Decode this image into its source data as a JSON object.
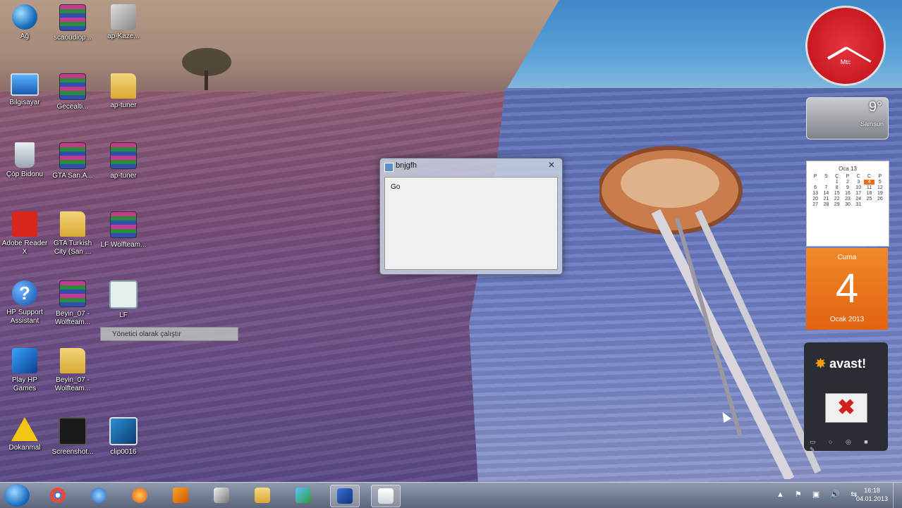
{
  "desktop": {
    "icons": [
      {
        "label": "Ağ",
        "type": "globe"
      },
      {
        "label": "scaoudiop...",
        "type": "rar"
      },
      {
        "label": "ap-Kaze...",
        "type": "setup"
      },
      {
        "label": "Bilgisayar",
        "type": "pc"
      },
      {
        "label": "Gecealti...",
        "type": "rar"
      },
      {
        "label": "ap-tuner",
        "type": "folder"
      },
      {
        "label": "Çöp Bidonu",
        "type": "trash"
      },
      {
        "label": "GTA San.A...",
        "type": "rar"
      },
      {
        "label": "ap-tuner",
        "type": "rar"
      },
      {
        "label": "Adobe Reader X",
        "type": "pdf"
      },
      {
        "label": "GTA Turkish City (San ...",
        "type": "folder"
      },
      {
        "label": "LF Wolfteam...",
        "type": "rar"
      },
      {
        "label": "HP Support Assistant",
        "type": "help"
      },
      {
        "label": "Beyin_07 - Wolfteam...",
        "type": "rar"
      },
      {
        "label": "LF",
        "type": "app"
      },
      {
        "label": "Play HP Games",
        "type": "games"
      },
      {
        "label": "Beyin_07 - Wolfteam...",
        "type": "folder"
      },
      {
        "label": "Dokanmal",
        "type": "warn"
      },
      {
        "label": "Screenshot...",
        "type": "shot"
      },
      {
        "label": "clip0016",
        "type": "clip"
      }
    ],
    "tooltip": "Yönetici olarak çalıştır"
  },
  "dialog": {
    "title": "bnjgfh",
    "close_glyph": "✕",
    "body_text": "Go"
  },
  "gadgets": {
    "clock": {
      "label": "Mtc"
    },
    "weather": {
      "temp": "9°",
      "city": "Samsun"
    },
    "calendar": {
      "month": "Oca 13",
      "weekdays": [
        "P",
        "S",
        "Ç",
        "P",
        "C",
        "C",
        "P"
      ],
      "days": [
        "",
        "",
        "1",
        "2",
        "3",
        "4",
        "5",
        "6",
        "7",
        "8",
        "9",
        "10",
        "11",
        "12",
        "13",
        "14",
        "15",
        "16",
        "17",
        "18",
        "19",
        "20",
        "21",
        "22",
        "23",
        "24",
        "25",
        "26",
        "27",
        "28",
        "29",
        "30",
        "31",
        "",
        "",
        "",
        ""
      ],
      "today": "4"
    },
    "day": {
      "weekday": "Cuma",
      "number": "4",
      "month_year": "Ocak 2013"
    },
    "avast": {
      "brand_prefix": "",
      "brand": "avast!",
      "x_glyph": "✖"
    }
  },
  "taskbar": {
    "items": [
      "chrome",
      "ie",
      "firefox",
      "media-player",
      "unity",
      "explorer",
      "messenger",
      "app-active",
      "notepad"
    ],
    "tray_icons": "▲ ⚑ ▣ 🔊 ⇆",
    "time": "16:18",
    "date": "04.01.2013"
  }
}
